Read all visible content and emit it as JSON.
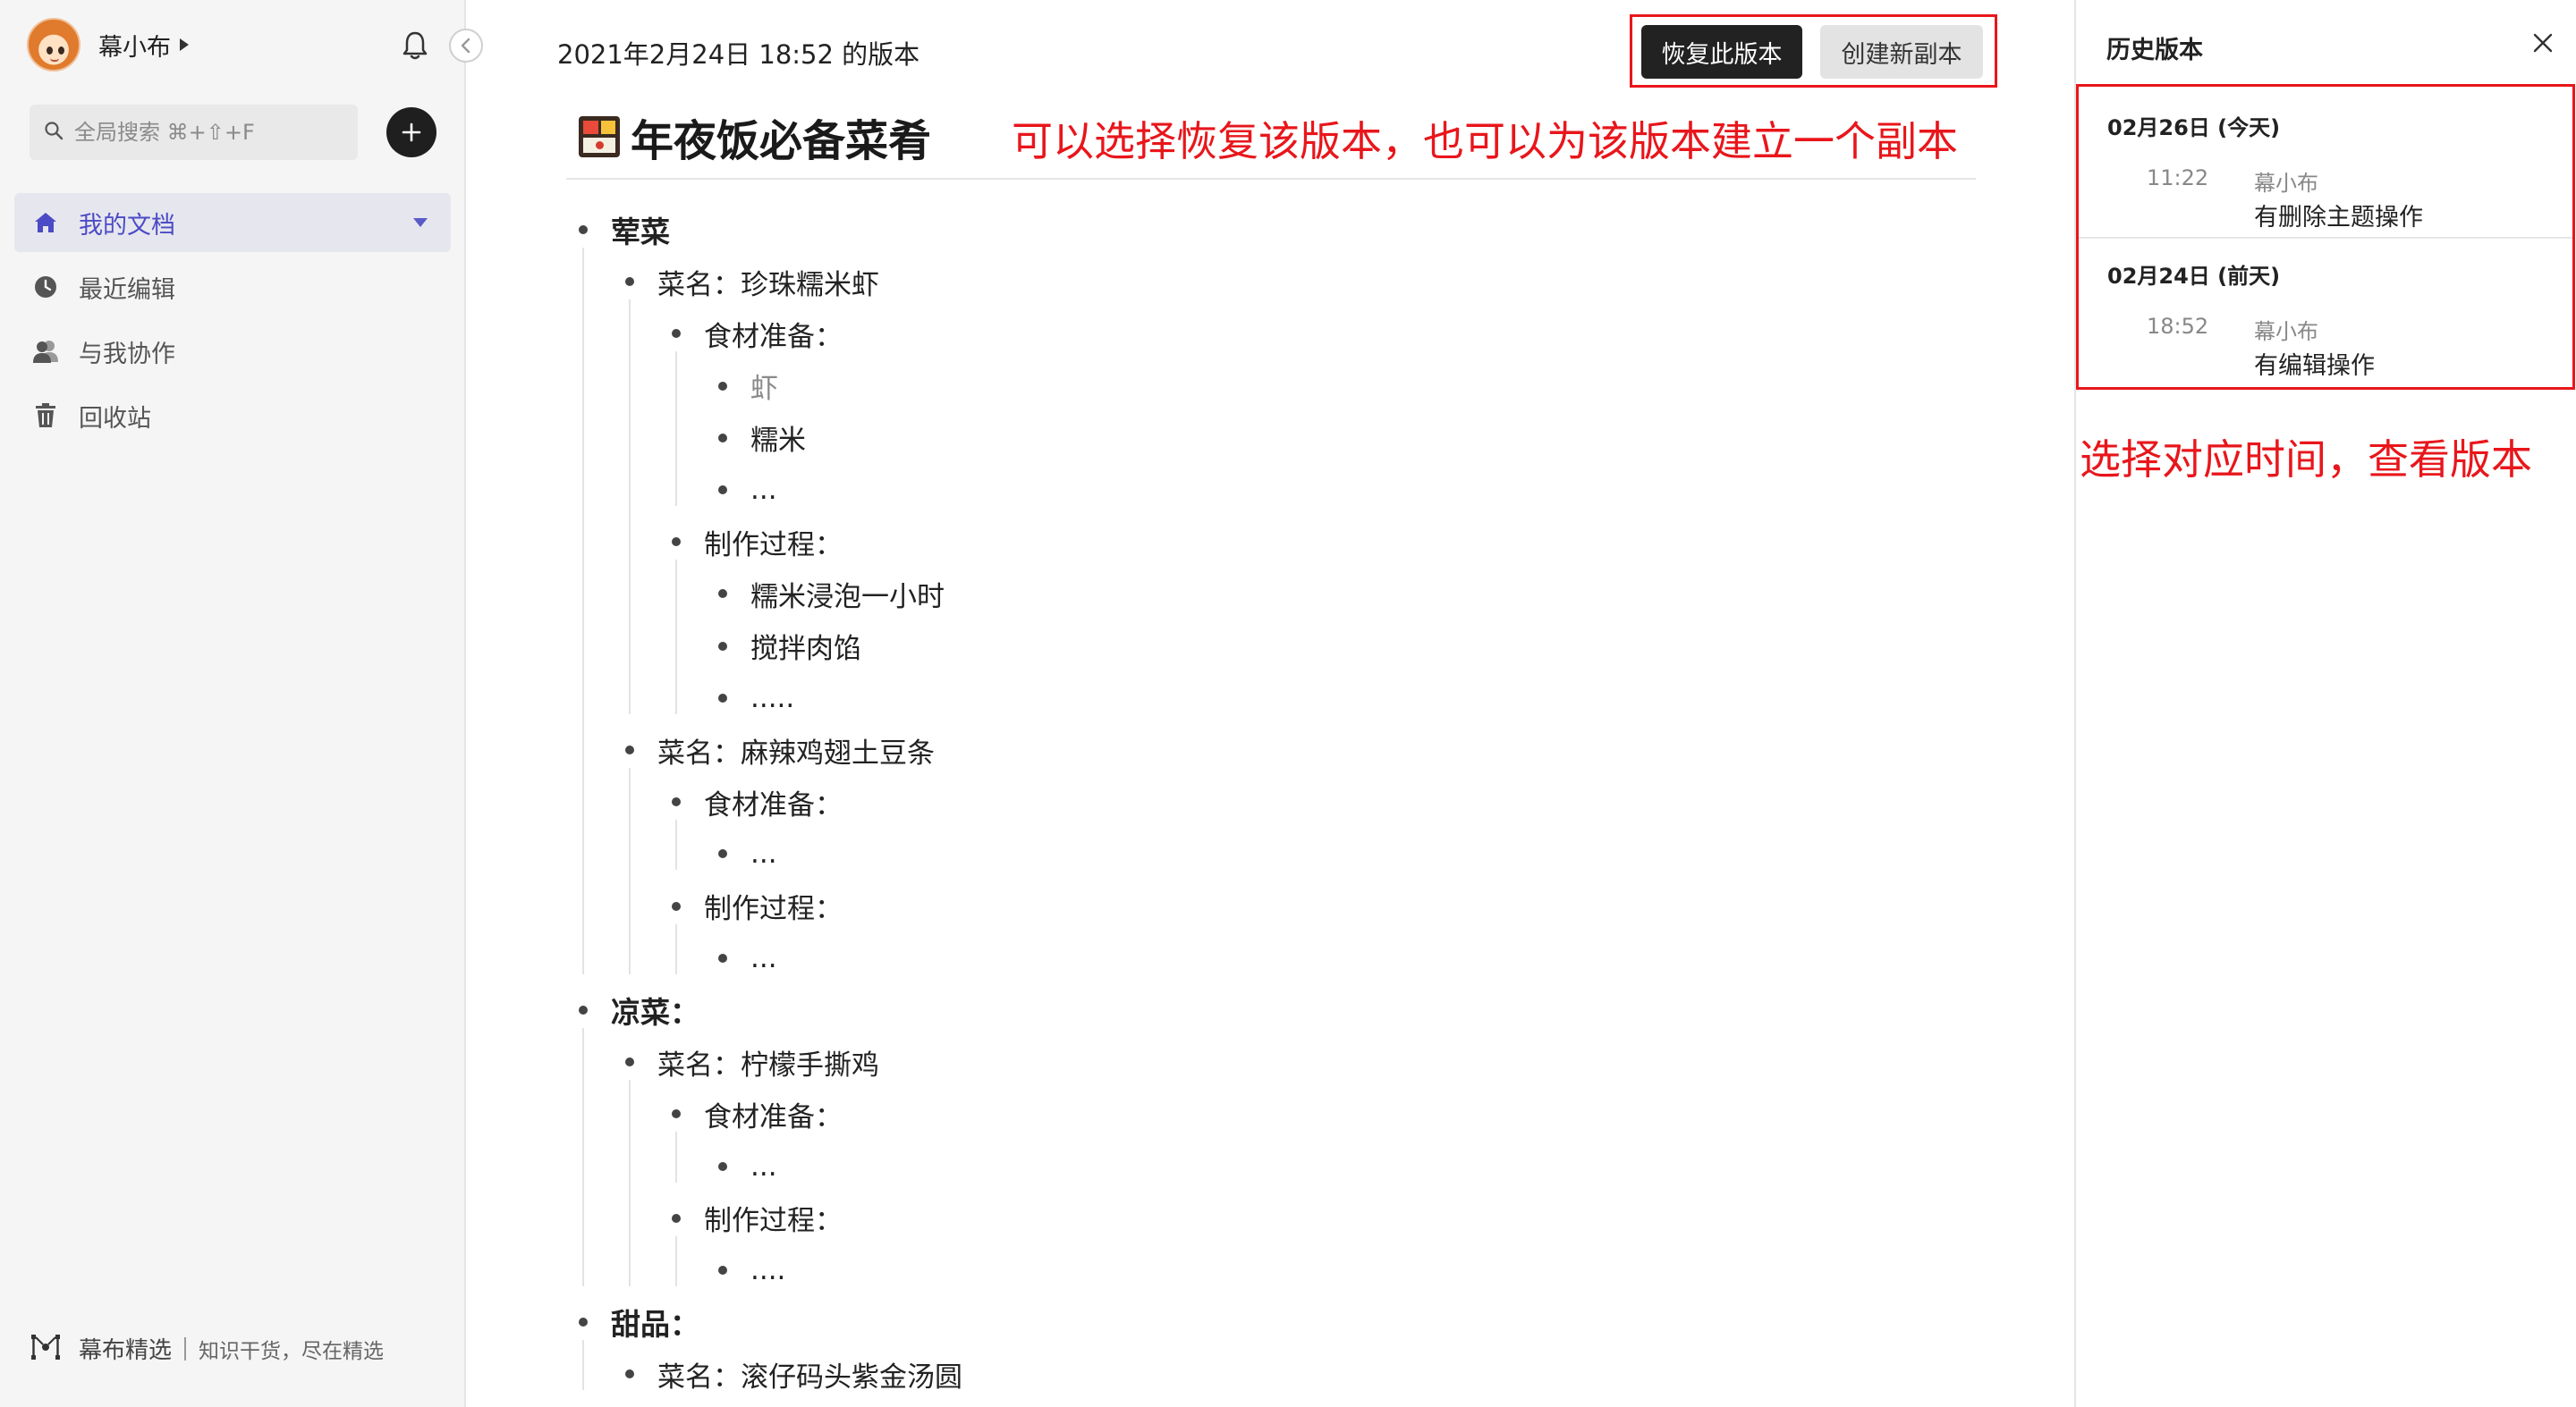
{
  "sidebar": {
    "username": "幕小布",
    "search": {
      "placeholder": "全局搜索 ⌘+⇧+F"
    },
    "nav": [
      {
        "label": "我的文档",
        "icon": "home-icon",
        "active": true
      },
      {
        "label": "最近编辑",
        "icon": "clock-icon"
      },
      {
        "label": "与我协作",
        "icon": "users-icon"
      },
      {
        "label": "回收站",
        "icon": "trash-icon"
      }
    ],
    "footer": {
      "brand": "幕布精选",
      "slogan": "知识干货，尽在精选"
    }
  },
  "main": {
    "version_title": "2021年2月24日 18:52 的版本",
    "restore_label": "恢复此版本",
    "copy_label": "创建新副本",
    "doc_title": "年夜饭必备菜肴",
    "annotation": "可以选择恢复该版本，也可以为该版本建立一个副本",
    "outline": [
      {
        "level": 0,
        "text": "荤菜"
      },
      {
        "level": 1,
        "text": "菜名：珍珠糯米虾"
      },
      {
        "level": 2,
        "text": "食材准备："
      },
      {
        "level": 3,
        "text": "虾",
        "muted": true
      },
      {
        "level": 3,
        "text": "糯米"
      },
      {
        "level": 3,
        "text": "..."
      },
      {
        "level": 2,
        "text": "制作过程："
      },
      {
        "level": 3,
        "text": "糯米浸泡一小时"
      },
      {
        "level": 3,
        "text": "搅拌肉馅"
      },
      {
        "level": 3,
        "text": "....."
      },
      {
        "level": 1,
        "text": "菜名：麻辣鸡翅土豆条"
      },
      {
        "level": 2,
        "text": "食材准备："
      },
      {
        "level": 3,
        "text": "..."
      },
      {
        "level": 2,
        "text": "制作过程："
      },
      {
        "level": 3,
        "text": "..."
      },
      {
        "level": 0,
        "text": "凉菜："
      },
      {
        "level": 1,
        "text": "菜名：柠檬手撕鸡"
      },
      {
        "level": 2,
        "text": "食材准备："
      },
      {
        "level": 3,
        "text": "..."
      },
      {
        "level": 2,
        "text": "制作过程："
      },
      {
        "level": 3,
        "text": "...."
      },
      {
        "level": 0,
        "text": "甜品："
      },
      {
        "level": 1,
        "text": "菜名：滚仔码头紫金汤圆"
      }
    ]
  },
  "history": {
    "title": "历史版本",
    "groups": [
      {
        "date": "02月26日 (今天)",
        "entries": [
          {
            "time": "11:22",
            "user": "幕小布",
            "action": "有删除主题操作"
          }
        ]
      },
      {
        "date": "02月24日 (前天)",
        "entries": [
          {
            "time": "18:52",
            "user": "幕小布",
            "action": "有编辑操作"
          }
        ]
      }
    ],
    "annotation": "选择对应时间，查看版本"
  },
  "colors": {
    "accent": "#4b4bc6",
    "annotation": "#e8161b",
    "dark_button": "#222222"
  }
}
